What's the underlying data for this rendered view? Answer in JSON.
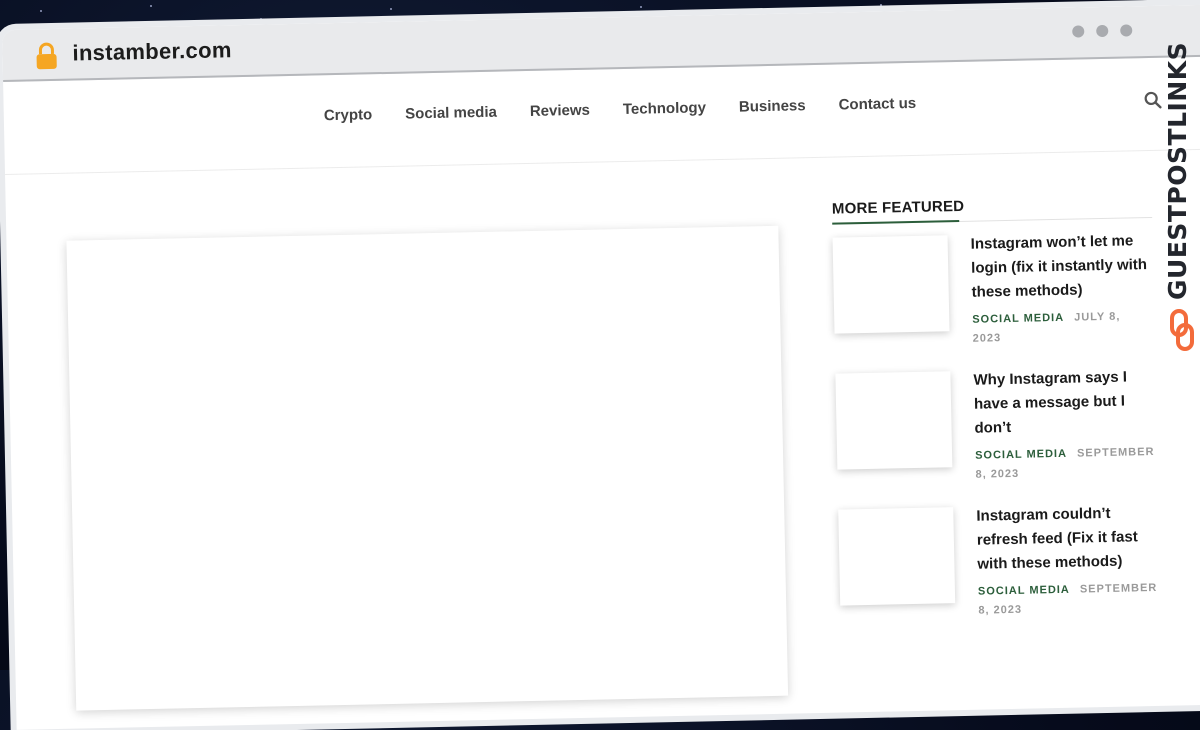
{
  "browser": {
    "url": "instamber.com"
  },
  "nav": {
    "items": [
      "Crypto",
      "Social media",
      "Reviews",
      "Technology",
      "Business",
      "Contact us"
    ]
  },
  "sidebar": {
    "title": "MORE FEATURED",
    "posts": [
      {
        "title": "Instagram won’t let me login (fix it instantly with these methods)",
        "category": "SOCIAL MEDIA",
        "date": "JULY 8, 2023"
      },
      {
        "title": "Why Instagram says I have a message but I don’t",
        "category": "SOCIAL MEDIA",
        "date": "SEPTEMBER 8, 2023"
      },
      {
        "title": "Instagram couldn’t refresh feed (Fix it fast with these methods)",
        "category": "SOCIAL MEDIA",
        "date": "SEPTEMBER 8, 2023"
      }
    ]
  },
  "badge": {
    "text": "GUESTPOSTLINKS"
  },
  "colors": {
    "accent_green": "#2c5e3b",
    "lock_orange": "#f5a623",
    "badge_orange": "#f36b3b",
    "background": "#060b1c"
  },
  "icons": {
    "lock": "padlock-icon",
    "search": "search-icon",
    "badge": "chain-link-icon"
  }
}
